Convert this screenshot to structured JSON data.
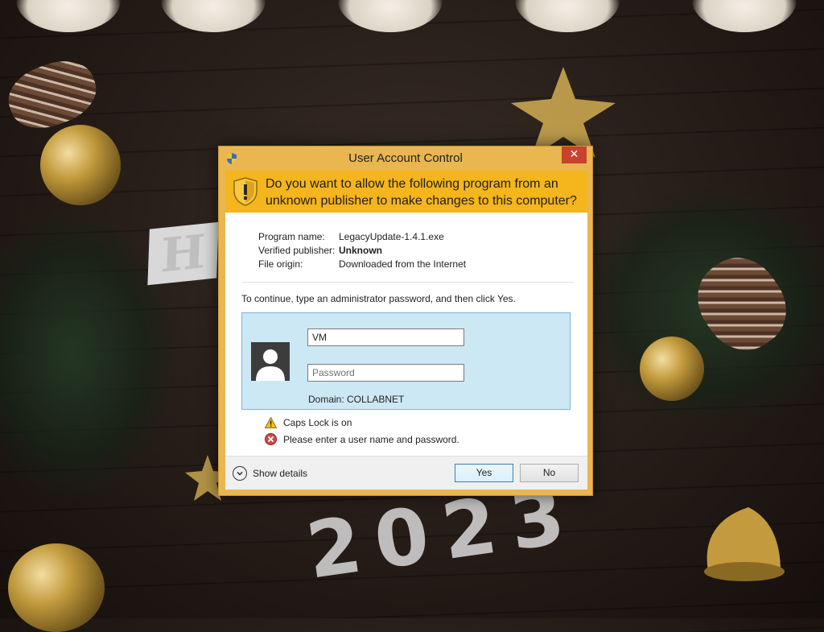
{
  "dialog": {
    "title": "User Account Control",
    "close_label": "✕",
    "question": "Do you want to allow the following program from an unknown publisher to make changes to this computer?",
    "info": [
      {
        "key": "Program name:",
        "value": "LegacyUpdate-1.4.1.exe",
        "bold": false
      },
      {
        "key": "Verified publisher:",
        "value": "Unknown",
        "bold": true
      },
      {
        "key": "File origin:",
        "value": "Downloaded from the Internet",
        "bold": false
      }
    ],
    "instruction": "To continue, type an administrator password, and then click Yes.",
    "credentials": {
      "username_value": "VM",
      "password_placeholder": "Password",
      "domain": "Domain: COLLABNET"
    },
    "messages": {
      "caps_lock": "Caps Lock is on",
      "error": "Please enter a user name and password."
    },
    "footer": {
      "show_details": "Show details",
      "yes": "Yes",
      "no": "No"
    }
  },
  "colors": {
    "frame": "#e9b64f",
    "header_band": "#f4b51d",
    "credential_box": "#cde8f5",
    "close_button": "#c7422f"
  },
  "icons": [
    "uac-shield-icon",
    "warning-shield-icon",
    "user-avatar-icon",
    "warning-icon",
    "error-icon",
    "chevron-down-icon",
    "close-icon"
  ]
}
